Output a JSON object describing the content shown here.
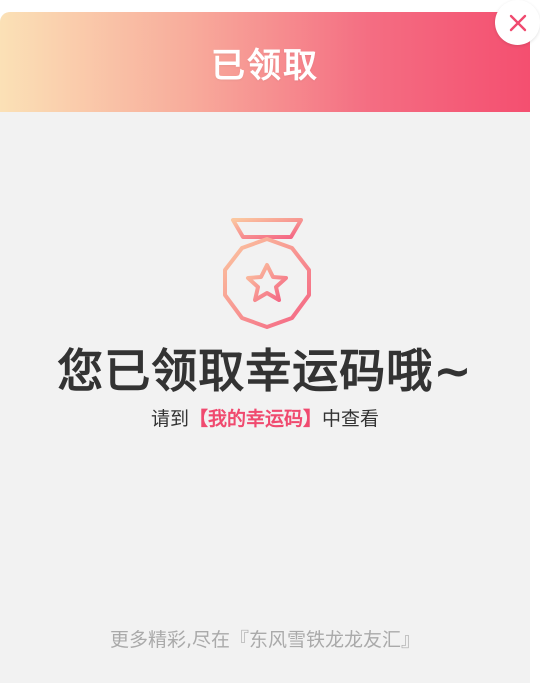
{
  "header": {
    "title": "已领取"
  },
  "close": {
    "icon": "close-icon"
  },
  "badge": {
    "icon": "medal-star-icon",
    "gradient": [
      "#fbc7a0",
      "#f46283"
    ]
  },
  "content": {
    "main_message": "您已领取幸运码哦~",
    "sub_prefix": "请到",
    "sub_highlight": "【我的幸运码】",
    "sub_suffix": "中查看"
  },
  "footer": {
    "text": "更多精彩,尽在『东风雪铁龙龙友汇』"
  },
  "colors": {
    "accent": "#f04a6f",
    "header_gradient_start": "#fbe1b6",
    "header_gradient_end": "#f44f70",
    "background": "#f2f2f2",
    "text_primary": "#333333",
    "text_muted": "#aaaaaa"
  }
}
